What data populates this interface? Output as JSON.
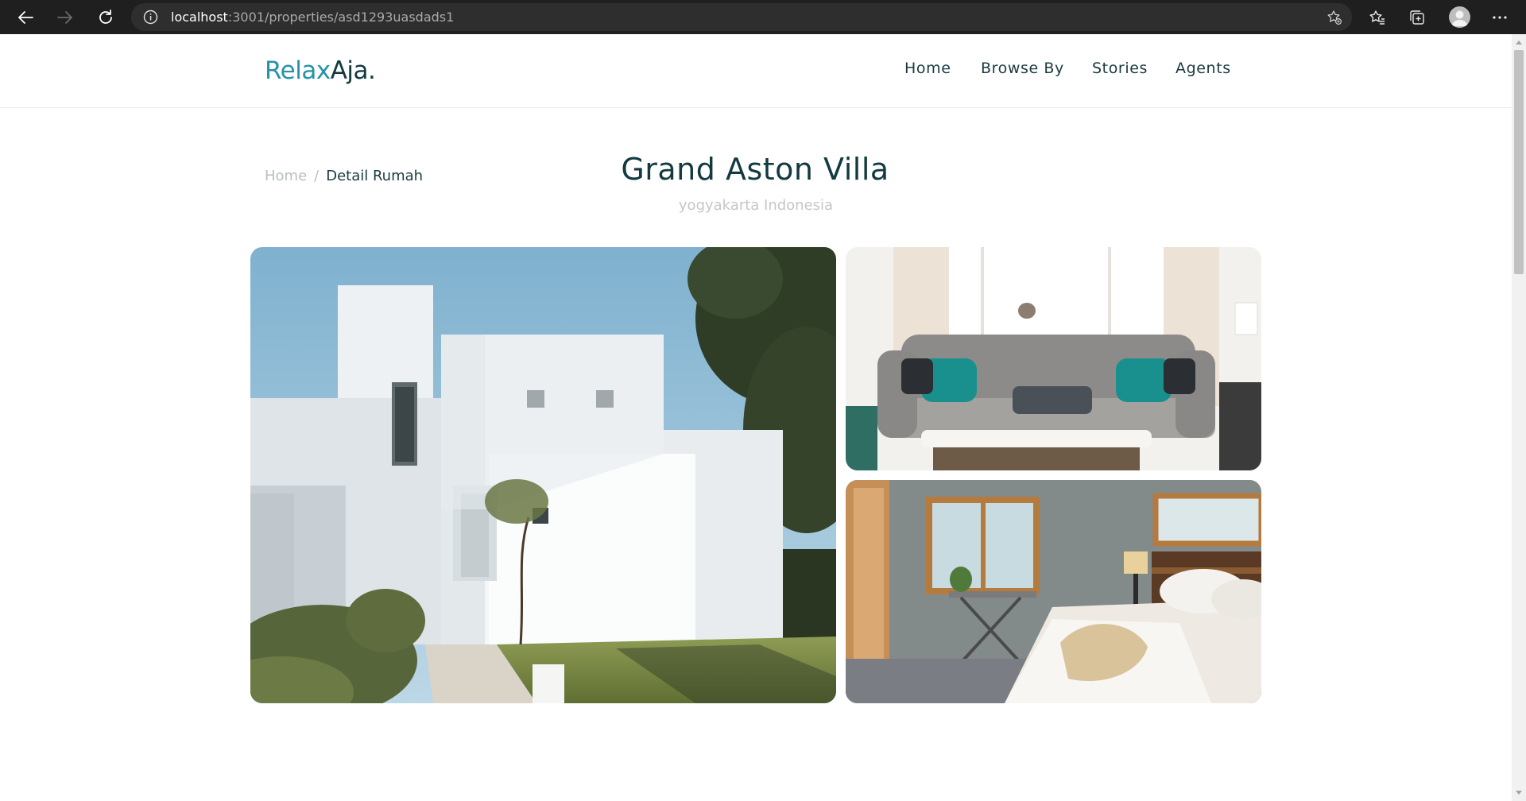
{
  "browser": {
    "url_host": "localhost",
    "url_rest": ":3001/properties/asd1293uasdads1"
  },
  "header": {
    "logo_part1": "Relax",
    "logo_part2": "Aja.",
    "nav": [
      {
        "label": "Home"
      },
      {
        "label": "Browse By"
      },
      {
        "label": "Stories"
      },
      {
        "label": "Agents"
      }
    ]
  },
  "breadcrumb": {
    "home": "Home",
    "separator": "/",
    "current": "Detail Rumah"
  },
  "property": {
    "title": "Grand Aston Villa",
    "location": "yogyakarta Indonesia"
  },
  "gallery": {
    "images": [
      {
        "subject": "white modern villa exterior"
      },
      {
        "subject": "grey sofa living room"
      },
      {
        "subject": "bedroom with window"
      }
    ]
  },
  "colors": {
    "brand_teal": "#2693a8",
    "dark_text": "#123a40",
    "muted_text": "#b9bfc4",
    "chrome_bg": "#1f1f1f"
  },
  "icons": [
    "back-arrow-icon",
    "forward-arrow-icon",
    "reload-icon",
    "info-icon",
    "add-favorite-icon",
    "favorites-icon",
    "collections-icon",
    "profile-avatar-icon",
    "more-menu-icon"
  ]
}
